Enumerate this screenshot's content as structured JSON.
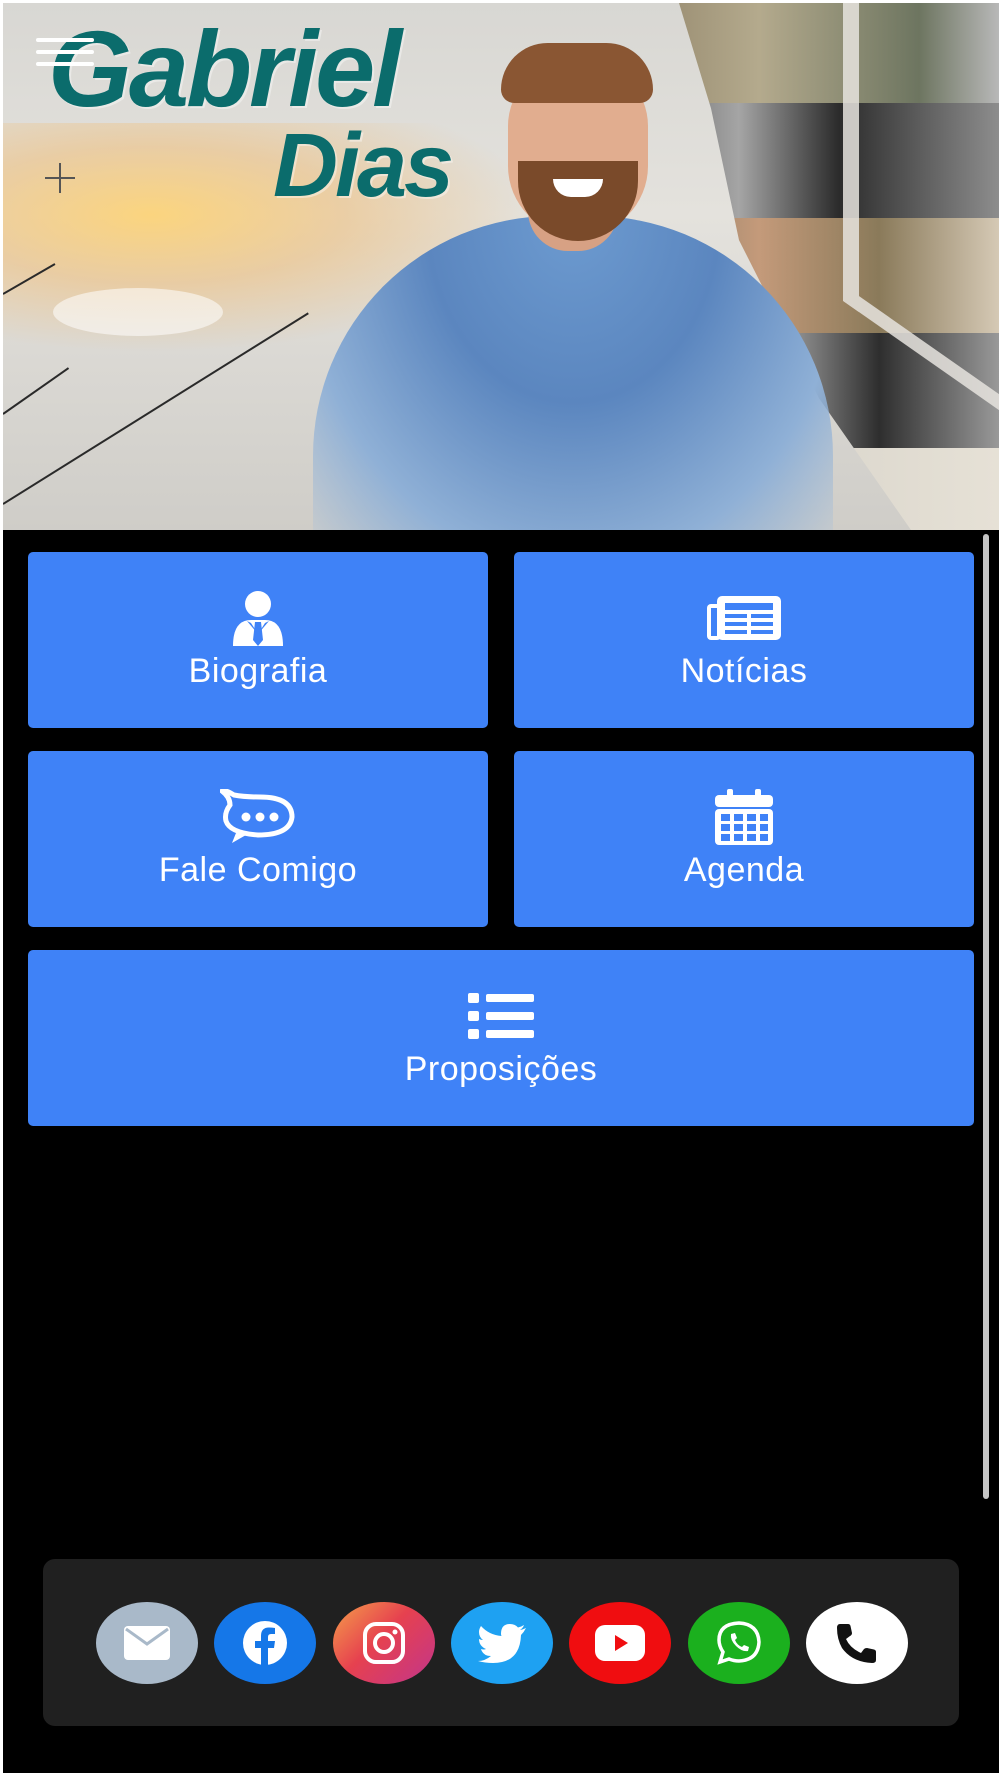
{
  "header": {
    "logo_first": "Gabriel",
    "logo_last": "Dias"
  },
  "menu": {
    "items": [
      {
        "label": "Biografia",
        "icon": "person-tie-icon"
      },
      {
        "label": "Notícias",
        "icon": "newspaper-icon"
      },
      {
        "label": "Fale Comigo",
        "icon": "chat-bubble-icon"
      },
      {
        "label": "Agenda",
        "icon": "calendar-icon"
      },
      {
        "label": "Proposições",
        "icon": "list-icon"
      }
    ],
    "tile_color": "#3f82f7"
  },
  "social": {
    "items": [
      {
        "name": "email",
        "icon": "envelope-icon",
        "color": "#a9b9c9"
      },
      {
        "name": "facebook",
        "icon": "facebook-icon",
        "color": "#1577e8"
      },
      {
        "name": "instagram",
        "icon": "instagram-icon",
        "color": "#e6414f"
      },
      {
        "name": "twitter",
        "icon": "twitter-icon",
        "color": "#1ea1f2"
      },
      {
        "name": "youtube",
        "icon": "youtube-icon",
        "color": "#f00d10"
      },
      {
        "name": "whatsapp",
        "icon": "whatsapp-icon",
        "color": "#1bb01e"
      },
      {
        "name": "phone",
        "icon": "phone-icon",
        "color": "#ffffff"
      }
    ]
  },
  "colors": {
    "background": "#000000",
    "logo": "#0b6c6c",
    "social_bar": "#202020"
  }
}
